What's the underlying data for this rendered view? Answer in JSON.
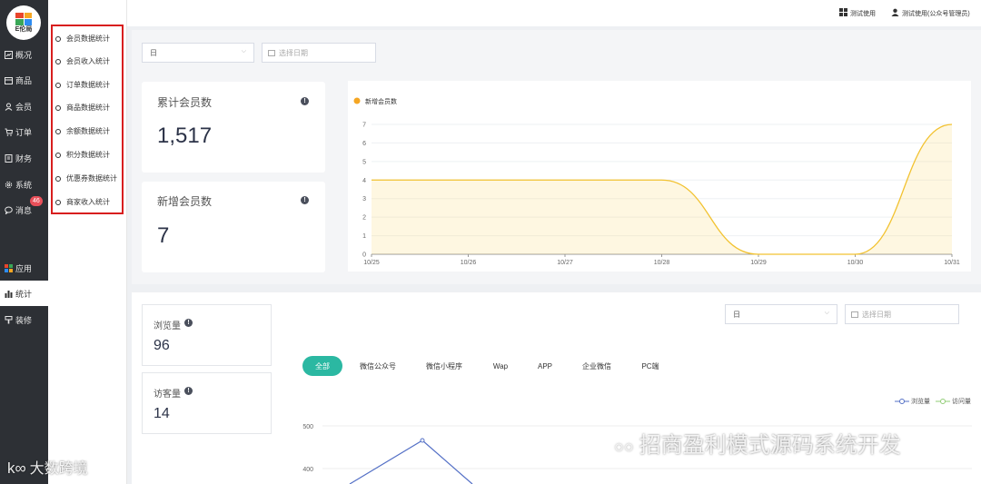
{
  "sidebar": {
    "logo_text": "E伦局",
    "items": [
      {
        "label": "概况",
        "icon": "overview-icon"
      },
      {
        "label": "商品",
        "icon": "goods-icon"
      },
      {
        "label": "会员",
        "icon": "member-icon"
      },
      {
        "label": "订单",
        "icon": "cart-icon"
      },
      {
        "label": "财务",
        "icon": "finance-icon"
      },
      {
        "label": "系统",
        "icon": "gear-icon"
      },
      {
        "label": "消息",
        "icon": "message-icon"
      },
      {
        "label": "应用",
        "icon": "apps-icon"
      },
      {
        "label": "统计",
        "icon": "bar-chart-icon"
      },
      {
        "label": "装修",
        "icon": "brush-icon"
      }
    ],
    "message_badge": "46"
  },
  "submenu": {
    "items": [
      "会员数据统计",
      "会员收入统计",
      "订单数据统计",
      "商品数据统计",
      "余额数据统计",
      "积分数据统计",
      "优惠券数据统计",
      "商家收入统计"
    ]
  },
  "header": {
    "test_use": "测试使用",
    "user": "测试使用(公众号管理员)"
  },
  "filter1": {
    "period": "日",
    "date_placeholder": "选择日期"
  },
  "cards": {
    "total_members_label": "累计会员数",
    "total_members_value": "1,517",
    "new_members_label": "新增会员数",
    "new_members_value": "7"
  },
  "chart_data": {
    "type": "area",
    "series": [
      {
        "name": "新增会员数",
        "values": [
          4,
          4,
          4,
          4,
          0,
          0,
          7
        ],
        "color": "#f5a623"
      }
    ],
    "x": [
      "10/25",
      "10/26",
      "10/27",
      "10/28",
      "10/29",
      "10/30",
      "10/31"
    ],
    "yticks": [
      "0",
      "1",
      "2",
      "3",
      "4",
      "5",
      "6",
      "7"
    ],
    "ylim": [
      0,
      7
    ],
    "grid": true,
    "legend": "top-left"
  },
  "traffic": {
    "views_label": "浏览量",
    "views_value": "96",
    "visitors_label": "访客量",
    "visitors_value": "14",
    "filter_period": "日",
    "filter_date_placeholder": "选择日期",
    "tabs": [
      "全部",
      "微信公众号",
      "微信小程序",
      "Wap",
      "APP",
      "企业微信",
      "PC端"
    ],
    "legend": [
      "浏览量",
      "访问量"
    ],
    "yticks": [
      "500",
      "400"
    ],
    "line_color": "#5470c6",
    "visitor_color": "#91cc75"
  },
  "watermarks": {
    "main": "招商盈利模式源码系统开发",
    "corner": "大数跨境"
  },
  "colors": {
    "accent": "#2bb8a2",
    "highlight": "#d81e1e",
    "sidebar_bg": "#2d3035"
  }
}
